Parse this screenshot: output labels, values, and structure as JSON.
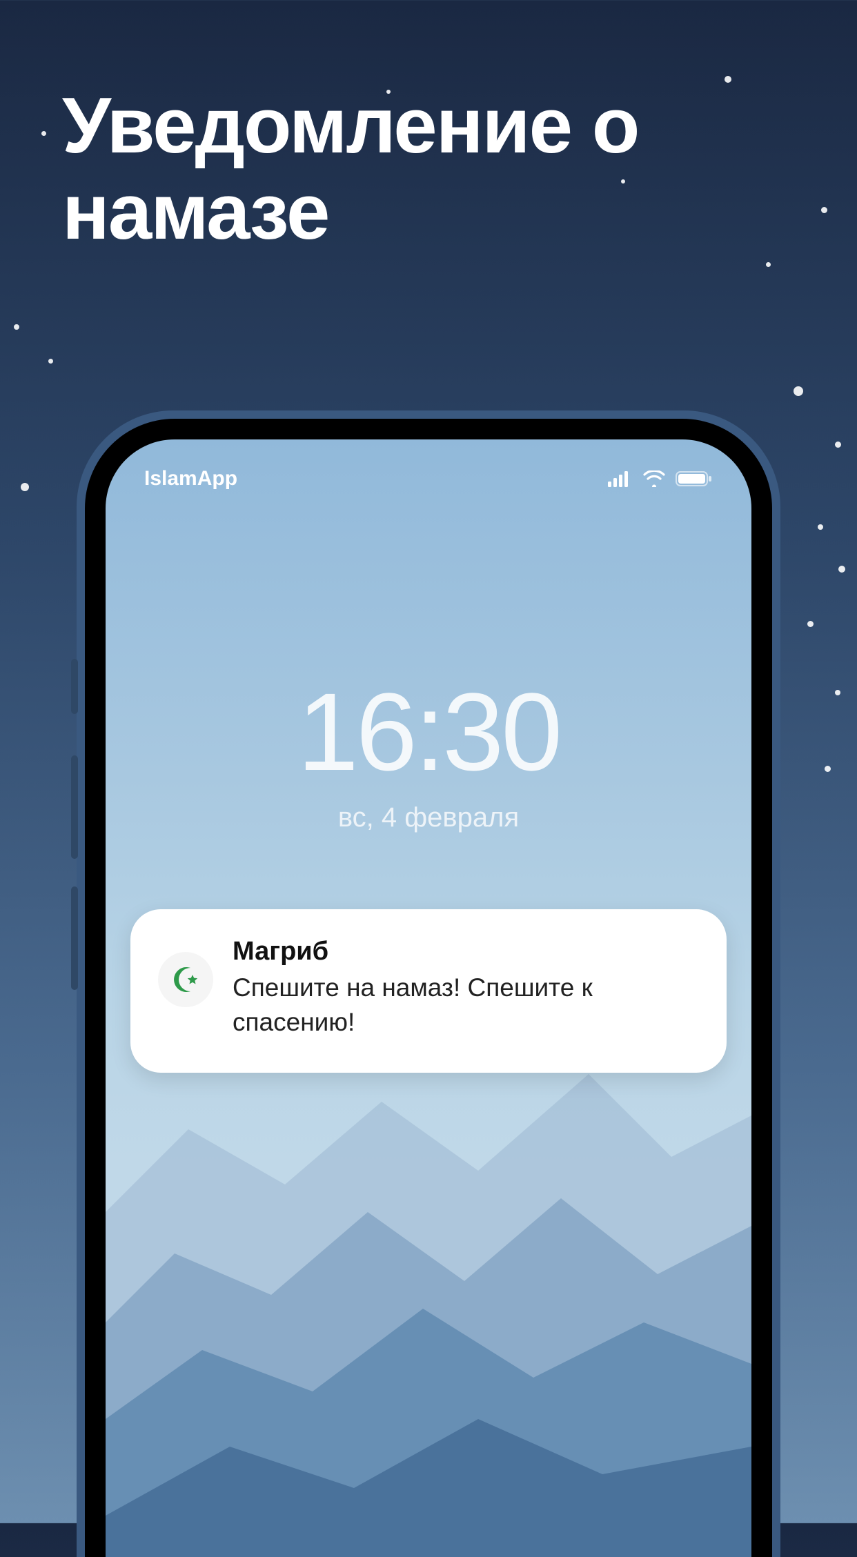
{
  "heading": "Уведомление о намазе",
  "status": {
    "carrier": "IslamApp"
  },
  "lockscreen": {
    "time": "16:30",
    "date": "вс, 4 февраля"
  },
  "notification": {
    "title": "Магриб",
    "body": "Спешите на намаз! Спешите к спасению!",
    "icon_name": "crescent-star-icon"
  },
  "colors": {
    "crescent": "#2e9a4a"
  }
}
